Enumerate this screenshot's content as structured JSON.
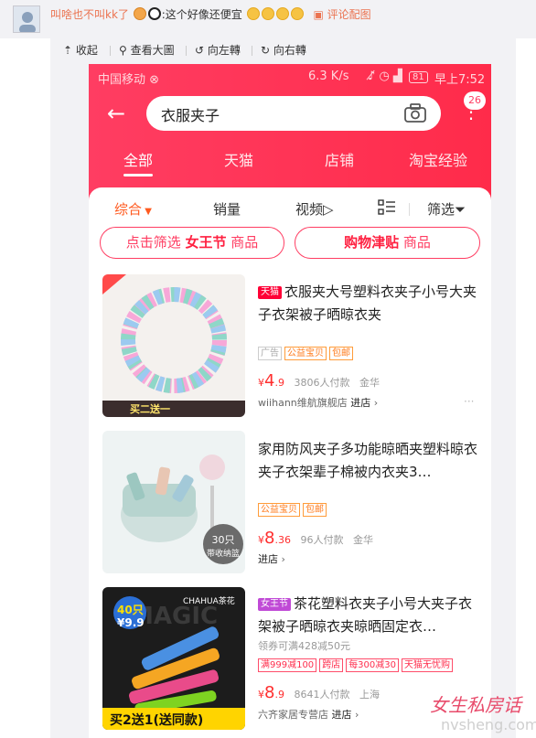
{
  "comment": {
    "user": "叫啥也不叫kk了",
    "separator": ":",
    "text": "这个好像还便宜",
    "reply_link": "评论配图"
  },
  "toolbar": {
    "collapse": "收起",
    "view_large": "查看大圖",
    "rotate_left": "向左轉",
    "rotate_right": "向右轉"
  },
  "status_bar": {
    "carrier": "中国移动",
    "speed": "6.3 K/s",
    "battery": "81",
    "time": "早上7:52"
  },
  "search": {
    "query": "衣服夹子",
    "cart_count": "26"
  },
  "tabs": [
    "全部",
    "天猫",
    "店铺",
    "淘宝经验"
  ],
  "sort": {
    "comprehensive": "综合",
    "sales": "销量",
    "video": "视频",
    "filter": "筛选"
  },
  "pills": {
    "left_pre": "点击筛选",
    "left_bold": "女王节",
    "left_post": "商品",
    "right_bold": "购物津贴",
    "right_post": "商品"
  },
  "products": [
    {
      "tag": "天猫",
      "title": "衣服夹大号塑料衣夹子小号大夹子衣架被子晒晾衣夹",
      "badges": [
        "广告",
        "公益宝贝",
        "包邮"
      ],
      "price_int": "4",
      "price_dec": ".9",
      "sold": "3806人付款",
      "location": "金华",
      "shop": "wiihann维航旗舰店",
      "enter": "进店",
      "img_banner": "买二送一"
    },
    {
      "tag": "",
      "title": "家用防风夹子多功能晾晒夹塑料晾衣夹子衣架辈子棉被内衣夹3…",
      "badges": [
        "公益宝贝",
        "包邮"
      ],
      "price_int": "8",
      "price_dec": ".36",
      "sold": "96人付款",
      "location": "金华",
      "shop": "",
      "enter": "进店",
      "img_label_1": "30只",
      "img_label_2": "带收纳篮"
    },
    {
      "tag": "女王节",
      "title": "茶花塑料衣夹子小号大夹子衣架被子晒晾衣夹晾晒固定衣…",
      "coupon": "领券可满428减50元",
      "badges": [
        "满999减100",
        "跨店",
        "每300减30",
        "天猫无忧购"
      ],
      "price_int": "8",
      "price_dec": ".9",
      "sold": "8641人付款",
      "location": "上海",
      "shop": "六齐家居专营店",
      "enter": "进店",
      "img_brand": "CHAHUA茶花",
      "img_count": "40只",
      "img_price": "¥9.9",
      "img_banner": "买2送1(送同款)",
      "img_bg_text": "MAGIC"
    }
  ],
  "watermark": {
    "line1": "女生私房话",
    "line2": "nvsheng.com"
  },
  "colors": {
    "brand": "#ff3d62",
    "price": "#ff2e2e",
    "weibo_link": "#eb7350"
  }
}
